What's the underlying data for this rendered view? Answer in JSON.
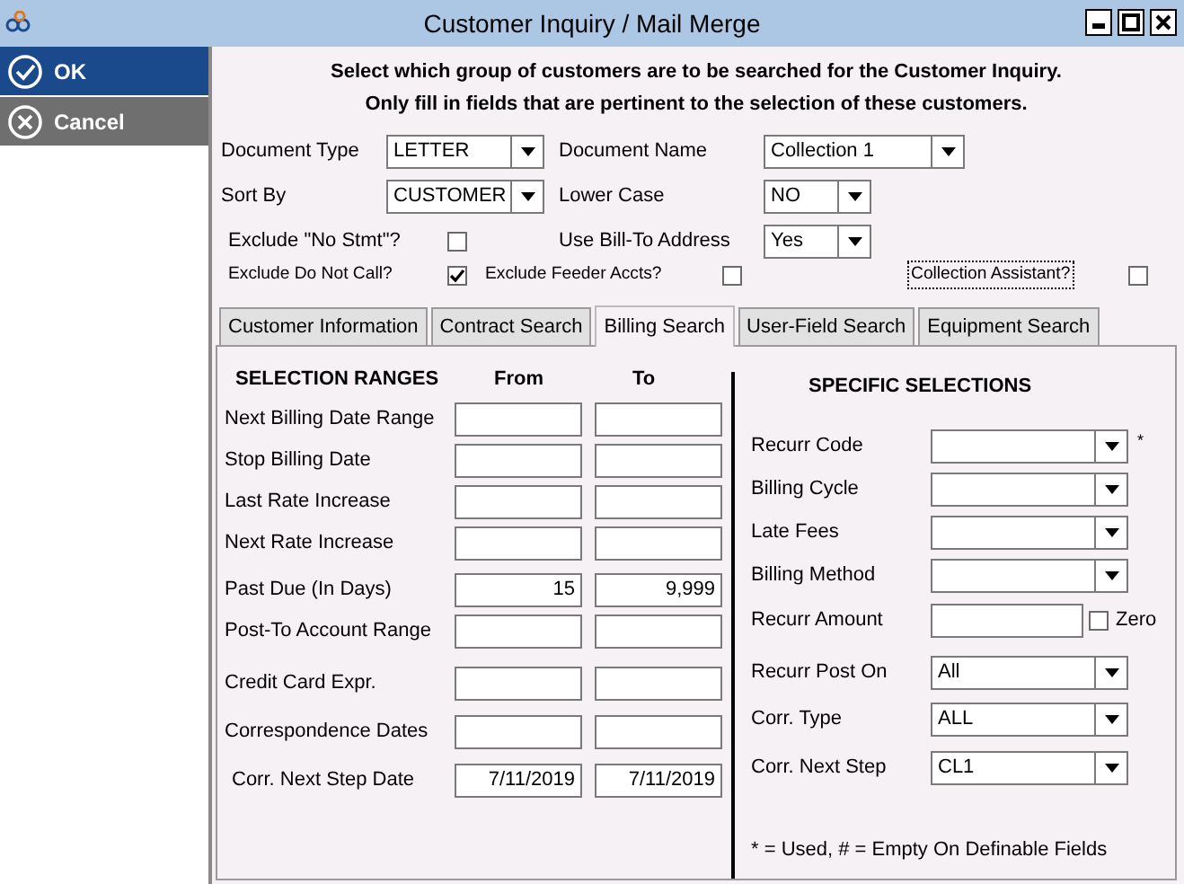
{
  "window": {
    "title": "Customer Inquiry / Mail Merge"
  },
  "sidebar": {
    "buttons": [
      {
        "label": "OK",
        "kind": "ok"
      },
      {
        "label": "Cancel",
        "kind": "cancel"
      }
    ]
  },
  "instructions": [
    "Select which group of customers are to be searched for the Customer Inquiry.",
    "Only fill in fields that are pertinent to the selection of these customers."
  ],
  "options": [
    {
      "fields": [
        {
          "label": "Document Type",
          "kind": "select",
          "value": "LETTER"
        },
        {
          "label": "Document Name",
          "kind": "select",
          "value": "Collection 1"
        }
      ]
    },
    {
      "fields": [
        {
          "label": "Sort By",
          "kind": "select",
          "value": "CUSTOMER"
        },
        {
          "label": "Lower Case",
          "kind": "select",
          "value": "NO"
        }
      ]
    },
    {
      "fields": [
        {
          "label": "Exclude \"No Stmt\"?",
          "kind": "checkbox",
          "checked": false
        },
        {
          "label": "Use Bill-To Address",
          "kind": "select",
          "value": "Yes"
        }
      ]
    },
    {
      "fields": [
        {
          "label": "Exclude Do Not Call?",
          "kind": "checkbox",
          "checked": true
        },
        {
          "label": "Exclude Feeder Accts?",
          "kind": "checkbox",
          "checked": false
        },
        {
          "label": "Collection Assistant?",
          "kind": "checkbox",
          "checked": false,
          "focused": true
        }
      ]
    }
  ],
  "tabs": [
    {
      "label": "Customer Information",
      "selected": false
    },
    {
      "label": "Contract Search",
      "selected": false
    },
    {
      "label": "Billing Search",
      "selected": true
    },
    {
      "label": "User-Field Search",
      "selected": false
    },
    {
      "label": "Equipment Search",
      "selected": false
    }
  ],
  "selection_ranges": {
    "title": "SELECTION RANGES",
    "from_heading": "From",
    "to_heading": "To",
    "rows": [
      {
        "label": "Next Billing Date Range"
      },
      {
        "label": "Stop Billing Date"
      },
      {
        "label": "Last Rate Increase"
      },
      {
        "label": "Next Rate Increase"
      },
      {
        "label": "Past Due (In Days)",
        "from": "15",
        "to": "9,999"
      },
      {
        "label": "Post-To Account Range"
      },
      {
        "label": "Credit Card Expr."
      },
      {
        "label": "Correspondence Dates"
      },
      {
        "label": "Corr. Next Step Date",
        "from": "7/11/2019",
        "to": "7/11/2019"
      }
    ]
  },
  "specific_selections": {
    "title": "SPECIFIC SELECTIONS",
    "rows": [
      {
        "label": "Recurr Code",
        "kind": "select",
        "marker": "*"
      },
      {
        "label": "Billing Cycle",
        "kind": "select"
      },
      {
        "label": "Late Fees",
        "kind": "select"
      },
      {
        "label": "Billing Method",
        "kind": "select"
      },
      {
        "label": "Recurr Amount",
        "kind": "amount",
        "zero_label": "Zero",
        "zero_checked": false
      },
      {
        "label": "Recurr Post On",
        "kind": "select",
        "value": "All"
      },
      {
        "label": "Corr. Type",
        "kind": "select",
        "value": "ALL"
      },
      {
        "label": "Corr. Next Step",
        "kind": "select",
        "value": "CL1"
      }
    ],
    "footnote": "* = Used, # = Empty On Definable Fields"
  }
}
